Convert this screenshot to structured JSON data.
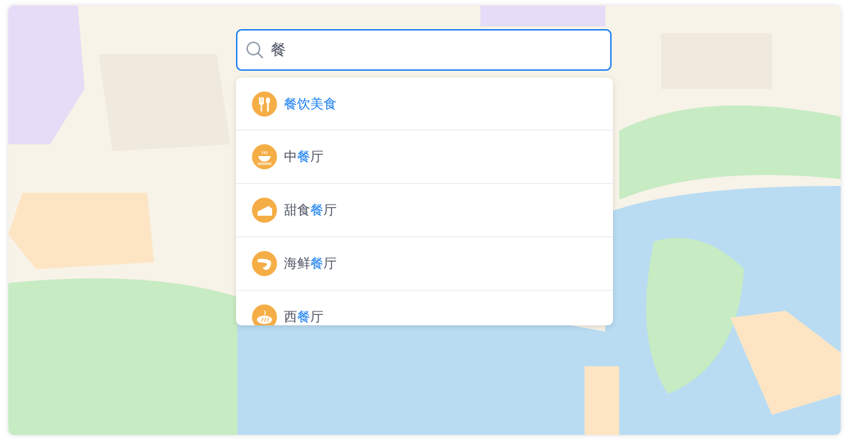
{
  "search": {
    "value": "餐"
  },
  "suggestions": [
    {
      "kind": "utensils",
      "parts": [
        {
          "text": "餐饮美食",
          "match": true
        }
      ]
    },
    {
      "kind": "bowl",
      "parts": [
        {
          "text": "中",
          "match": false
        },
        {
          "text": "餐",
          "match": true
        },
        {
          "text": "厅",
          "match": false
        }
      ]
    },
    {
      "kind": "cake",
      "parts": [
        {
          "text": "甜食",
          "match": false
        },
        {
          "text": "餐",
          "match": true
        },
        {
          "text": "厅",
          "match": false
        }
      ]
    },
    {
      "kind": "shrimp",
      "parts": [
        {
          "text": "海鲜",
          "match": false
        },
        {
          "text": "餐",
          "match": true
        },
        {
          "text": "厅",
          "match": false
        }
      ]
    },
    {
      "kind": "bread",
      "parts": [
        {
          "text": "西",
          "match": false
        },
        {
          "text": "餐",
          "match": true
        },
        {
          "text": "厅",
          "match": false
        }
      ]
    }
  ]
}
